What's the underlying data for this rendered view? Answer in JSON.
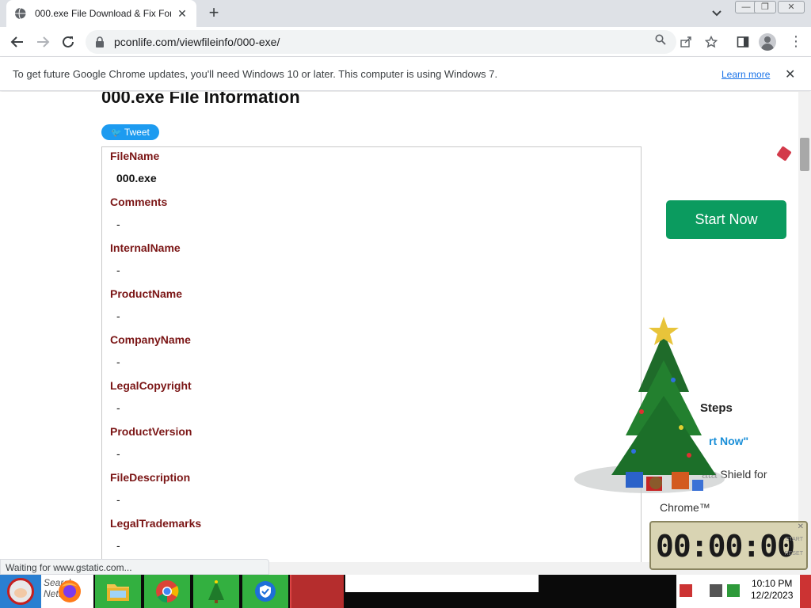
{
  "browser": {
    "tab_title": "000.exe File Download & Fix For",
    "tab_close": "✕",
    "new_tab": "+",
    "url": "pconlife.com/viewfileinfo/000-exe/",
    "menu_glyph": "⋮"
  },
  "window_controls": {
    "minimize": "—",
    "restore": "❐",
    "close": "✕"
  },
  "infobar": {
    "message": "To get future Google Chrome updates, you'll need Windows 10 or later. This computer is using Windows 7.",
    "link": "Learn more",
    "close": "✕"
  },
  "page": {
    "title": "000.exe File Information",
    "tweet_label": "Tweet",
    "tweet_glyph": "🐦",
    "fields": [
      {
        "label": "FileName",
        "value": "000.exe"
      },
      {
        "label": "Comments",
        "value": "-"
      },
      {
        "label": "InternalName",
        "value": "-"
      },
      {
        "label": "ProductName",
        "value": "-"
      },
      {
        "label": "CompanyName",
        "value": "-"
      },
      {
        "label": "LegalCopyright",
        "value": "-"
      },
      {
        "label": "ProductVersion",
        "value": "-"
      },
      {
        "label": "FileDescription",
        "value": "-"
      },
      {
        "label": "LegalTrademarks",
        "value": "-"
      }
    ],
    "sidebar": {
      "start_button": "Start Now",
      "steps_heading": "Steps",
      "start_now_quote": "rt Now\"",
      "shield_text": "ata Shield for",
      "chrome_text": "Chrome™"
    }
  },
  "status_bar": "Waiting for www.gstatic.com...",
  "timer": {
    "display": "00:00:00",
    "close": "✕",
    "start": "START",
    "reset": "RESET"
  },
  "taskbar": {
    "search_text": "Search Netw",
    "tray_time": "10:10 PM",
    "tray_date": "12/2/2023"
  },
  "colors": {
    "accent": "#1a73e8",
    "field_label": "#7b1616",
    "start_now": "#0b9b5f",
    "tweet": "#1d9bf0"
  }
}
